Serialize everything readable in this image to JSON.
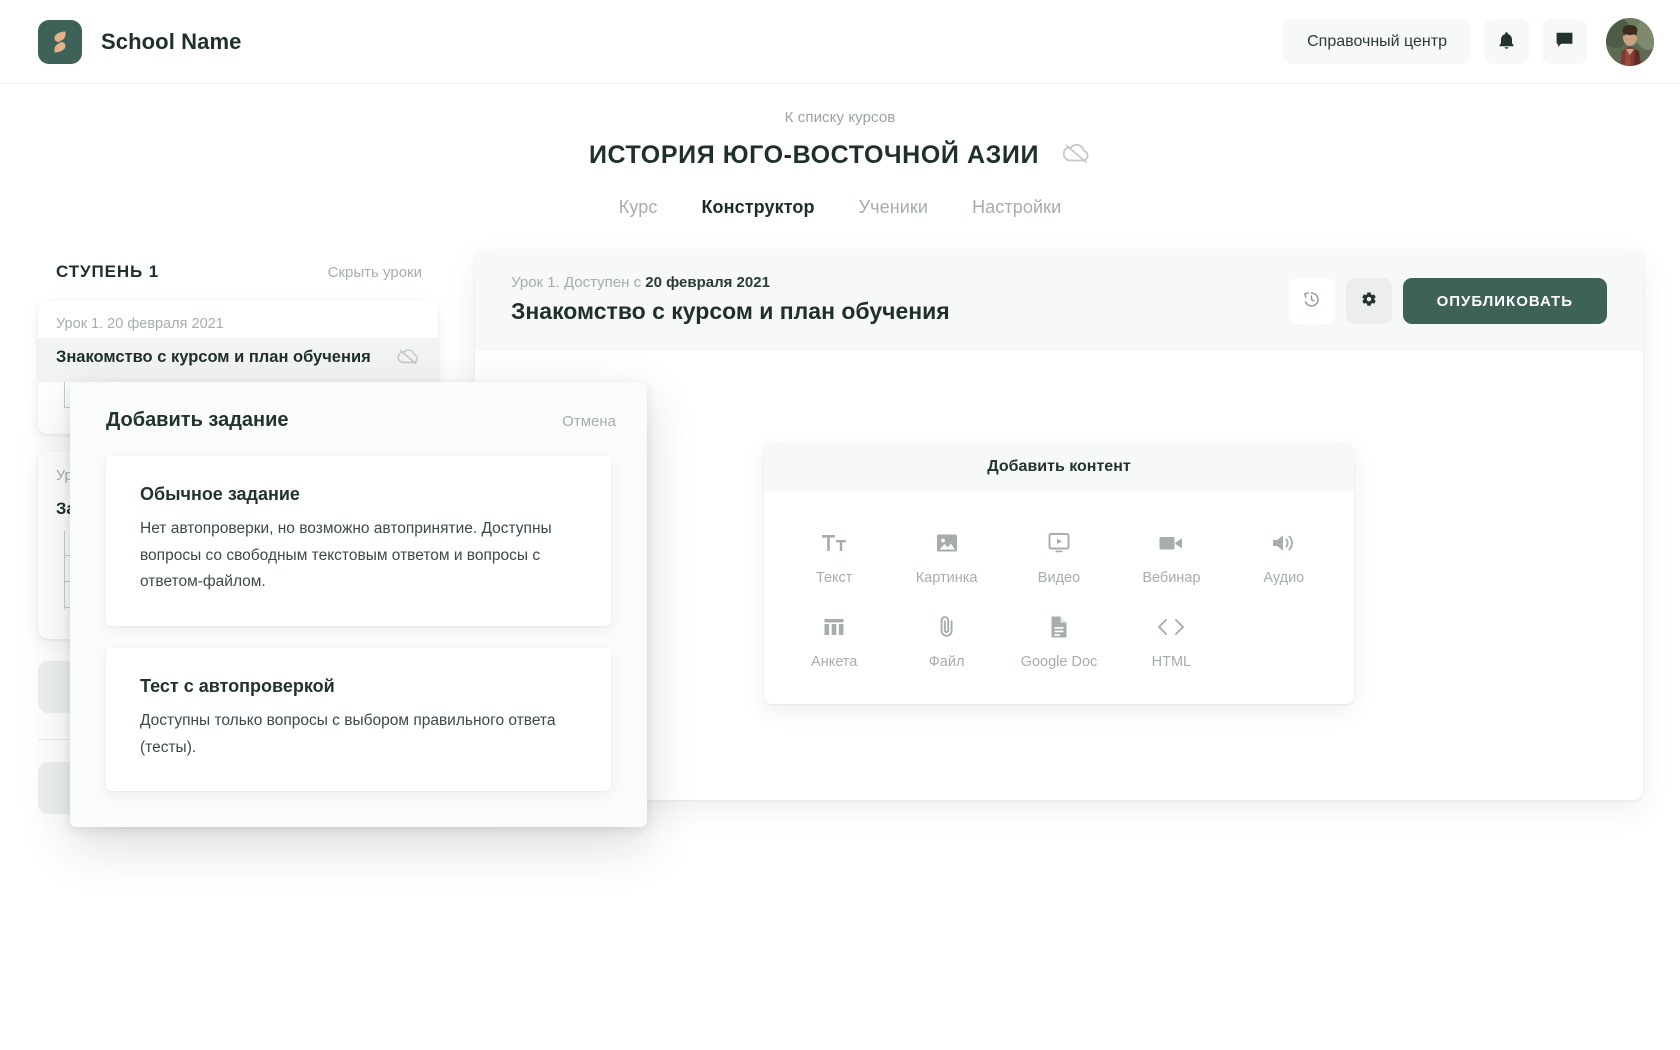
{
  "topbar": {
    "brand_name": "School Name",
    "logo_icon": "school-logo-icon",
    "help_label": "Справочный центр",
    "bell_icon": "bell-icon",
    "chat_icon": "chat-icon",
    "avatar_icon": "user-avatar"
  },
  "course": {
    "breadcrumb": "К списку курсов",
    "title": "ИСТОРИЯ ЮГО-ВОСТОЧНОЙ АЗИИ",
    "status_icon": "cloud-off-icon",
    "tabs": [
      {
        "label": "Курс",
        "active": false
      },
      {
        "label": "Конструктор",
        "active": true
      },
      {
        "label": "Ученики",
        "active": false
      },
      {
        "label": "Настройки",
        "active": false
      }
    ]
  },
  "sidebar": {
    "step_title": "СТУПЕНЬ 1",
    "toggle_label": "Скрыть уроки",
    "lessons": [
      {
        "meta": "Урок 1. 20 февраля 2021",
        "title": "Знакомство с курсом и план обучения",
        "status_icon": "cloud-off-icon"
      },
      {
        "meta": "Ур",
        "title": "За"
      }
    ]
  },
  "lesson_panel": {
    "meta_prefix": "Урок 1. Доступен с ",
    "meta_date": "20 февраля 2021",
    "title": "Знакомство с курсом и план обучения",
    "history_icon": "history-icon",
    "settings_icon": "gear-icon",
    "publish_label": "ОПУБЛИКОВАТЬ",
    "publish_color": "#3e6158"
  },
  "add_content": {
    "heading": "Добавить контент",
    "tiles": [
      {
        "label": "Текст",
        "icon": "text-icon"
      },
      {
        "label": "Картинка",
        "icon": "image-icon"
      },
      {
        "label": "Видео",
        "icon": "video-icon"
      },
      {
        "label": "Вебинар",
        "icon": "webinar-camera-icon"
      },
      {
        "label": "Аудио",
        "icon": "audio-icon"
      },
      {
        "label": "Анкета",
        "icon": "survey-icon"
      },
      {
        "label": "Файл",
        "icon": "paperclip-icon"
      },
      {
        "label": "Google Doc",
        "icon": "document-icon"
      },
      {
        "label": "HTML",
        "icon": "code-icon"
      }
    ]
  },
  "add_task_modal": {
    "title": "Добавить задание",
    "cancel_label": "Отмена",
    "options": [
      {
        "title": "Обычное задание",
        "desc": "Нет автопроверки, но возможно автопринятие. Доступны вопросы со свободным текстовым ответом и вопросы с ответом-файлом."
      },
      {
        "title": "Тест с автопроверкой",
        "desc": "Доступны только вопросы с выбором правильного ответа (тесты)."
      }
    ]
  }
}
